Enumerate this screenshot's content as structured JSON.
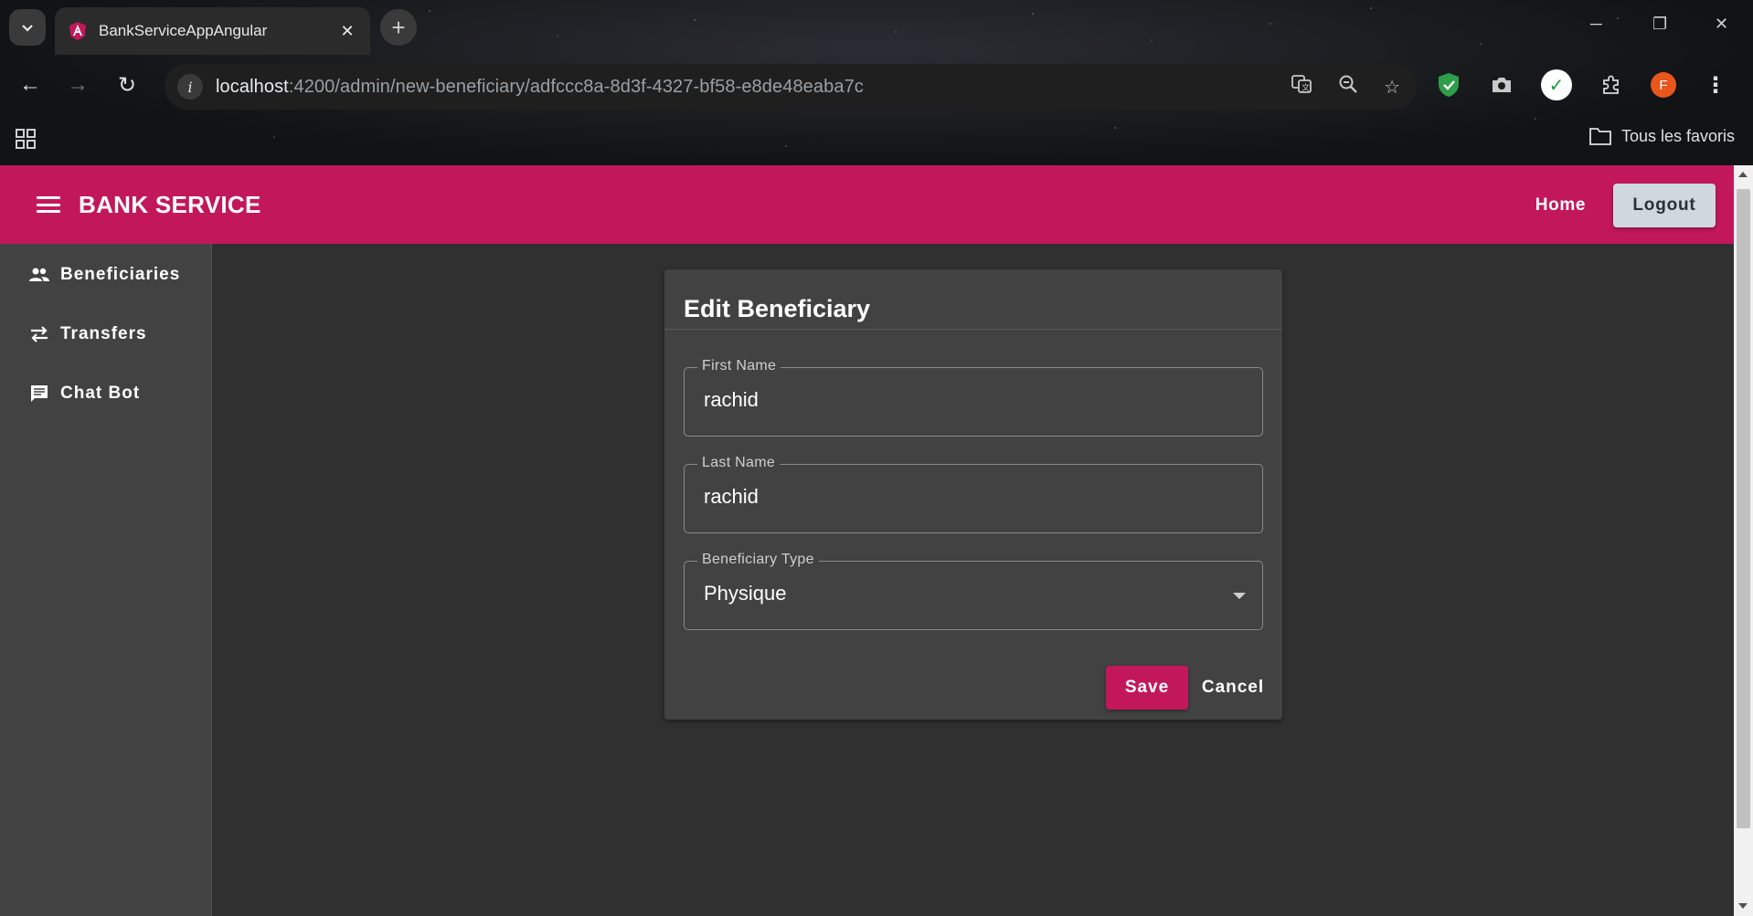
{
  "browser": {
    "tab_title": "BankServiceAppAngular",
    "url_host": "localhost",
    "url_path": ":4200/admin/new-beneficiary/adfccc8a-8d3f-4327-bf58-e8de48eaba7c",
    "bookmarks_folder": "Tous les favoris",
    "profile_initial": "F"
  },
  "header": {
    "brand": "BANK SERVICE",
    "home_label": "Home",
    "logout_label": "Logout"
  },
  "sidebar": {
    "items": [
      {
        "label": "Beneficiaries",
        "icon": "people-icon"
      },
      {
        "label": "Transfers",
        "icon": "swap-arrows-icon"
      },
      {
        "label": "Chat Bot",
        "icon": "chat-icon"
      }
    ]
  },
  "form": {
    "title": "Edit Beneficiary",
    "first_name": {
      "label": "First Name",
      "value": "rachid"
    },
    "last_name": {
      "label": "Last Name",
      "value": "rachid"
    },
    "beneficiary_type": {
      "label": "Beneficiary Type",
      "value": "Physique"
    },
    "save_label": "Save",
    "cancel_label": "Cancel"
  },
  "colors": {
    "primary": "#c2185b",
    "sidenav": "#424242",
    "content_bg": "#303030",
    "card_bg": "#424242",
    "logout_bg": "#cfd8dc"
  }
}
